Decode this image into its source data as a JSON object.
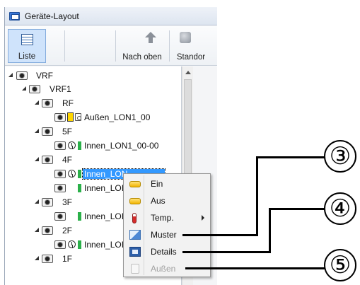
{
  "window": {
    "title": "Geräte-Layout"
  },
  "toolbar": {
    "list_label": "Liste",
    "up_label": "Nach oben",
    "location_label": "Standor"
  },
  "tree": {
    "root": "VRF",
    "system": "VRF1",
    "floors": [
      "RF",
      "5F",
      "4F",
      "3F",
      "2F",
      "1F"
    ],
    "units": {
      "rf_outdoor": "Außen_LON1_00",
      "f5_indoor": "Innen_LON1_00-00",
      "f4_indoor_selected": "Innen_LON",
      "f4_indoor_2": "Innen_LOI",
      "f3_indoor": "Innen_LOI",
      "f2_indoor": "Innen_LOI"
    }
  },
  "context_menu": {
    "items": [
      "Ein",
      "Aus",
      "Temp.",
      "Muster",
      "Details",
      "Außen"
    ],
    "disabled_item": "Außen"
  },
  "callouts": [
    "③",
    "④",
    "⑤"
  ]
}
